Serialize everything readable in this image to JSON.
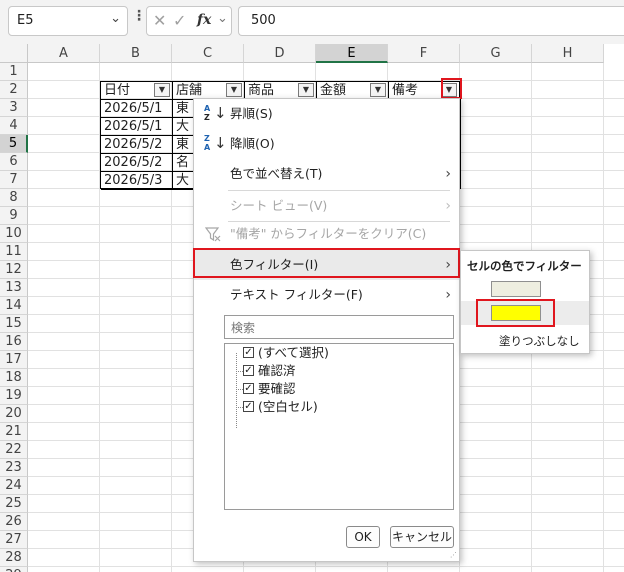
{
  "formula_bar": {
    "name_box": "E5",
    "name_box_arrow": "⌄",
    "dots": "⋮",
    "cancel_icon": "✕",
    "enter_icon": "✓",
    "fx_label": "fx",
    "fx_arrow": "⌄",
    "formula_value": "500"
  },
  "columns": [
    "A",
    "B",
    "C",
    "D",
    "E",
    "F",
    "G",
    "H"
  ],
  "selected_column": "E",
  "rows": [
    "1",
    "2",
    "3",
    "4",
    "5",
    "6",
    "7",
    "8",
    "9",
    "10",
    "11",
    "12",
    "13",
    "14",
    "15",
    "16",
    "17",
    "18",
    "19",
    "20",
    "21",
    "22",
    "23",
    "24",
    "25",
    "26",
    "27",
    "28",
    "29"
  ],
  "selected_row": "5",
  "table": {
    "headers": [
      "日付",
      "店舗",
      "商品",
      "金額",
      "備考"
    ],
    "dates": [
      "2026/5/1",
      "2026/5/1",
      "2026/5/2",
      "2026/5/2",
      "2026/5/3"
    ],
    "stores": [
      "東",
      "大",
      "東",
      "名",
      "大"
    ],
    "dropdown_arrow": "▼"
  },
  "filter_menu": {
    "sort_asc": "昇順(S)",
    "sort_desc": "降順(O)",
    "sort_by_color": "色で並べ替え(T)",
    "sheet_view": "シート ビュー(V)",
    "clear_filter": "\"備考\" からフィルターをクリア(C)",
    "color_filter": "色フィルター(I)",
    "text_filter": "テキスト フィルター(F)",
    "search_placeholder": "検索",
    "items": [
      {
        "label": "(すべて選択)",
        "checked": true
      },
      {
        "label": "確認済",
        "checked": true
      },
      {
        "label": "要確認",
        "checked": true
      },
      {
        "label": "(空白セル)",
        "checked": true
      }
    ],
    "check_mark": "✓",
    "ok_label": "OK",
    "cancel_label": "キャンセル",
    "submenu_arrow": "›",
    "sort_az_top": "A",
    "sort_az_bottom": "Z",
    "sort_za_top": "Z",
    "sort_za_bottom": "A",
    "sort_arrow": "↓"
  },
  "color_submenu": {
    "title": "セルの色でフィルター",
    "swatches": [
      {
        "color": "#eeeee0"
      },
      {
        "color": "#ffff00"
      }
    ],
    "no_fill": "塗りつぶしなし"
  },
  "colors": {
    "accent_green": "#217346",
    "highlight_red": "#e0161e",
    "swatch_yellow": "#ffff00",
    "swatch_beige": "#eeeee0"
  }
}
